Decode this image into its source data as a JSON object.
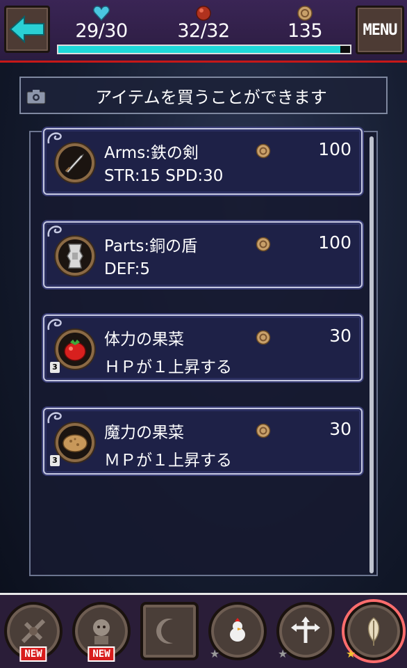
{
  "header": {
    "hp": "29/30",
    "mp": "32/32",
    "gold": "135",
    "menu_label": "MENU",
    "hp_fraction": 0.967
  },
  "notice": {
    "text": "アイテムを買うことができます"
  },
  "shop": {
    "items": [
      {
        "name": "Arms:鉄の剣",
        "desc": "STR:15  SPD:30",
        "price": "100",
        "icon": "iron-sword-icon",
        "qty": ""
      },
      {
        "name": "Parts:銅の盾",
        "desc": "DEF:5",
        "price": "100",
        "icon": "copper-shield-icon",
        "qty": ""
      },
      {
        "name": "体力の果菜",
        "desc": "ＨＰが１上昇する",
        "price": "30",
        "icon": "red-fruit-icon",
        "qty": "3"
      },
      {
        "name": "魔力の果菜",
        "desc": "ＭＰが１上昇する",
        "price": "30",
        "icon": "bread-fruit-icon",
        "qty": "3"
      }
    ]
  },
  "bottom_nav": {
    "items": [
      {
        "icon": "skills-icon",
        "badge": "NEW"
      },
      {
        "icon": "character-icon",
        "badge": "NEW"
      },
      {
        "icon": "moon-icon",
        "badge": ""
      },
      {
        "icon": "chicken-icon",
        "badge": ""
      },
      {
        "icon": "crossroad-icon",
        "badge": ""
      },
      {
        "icon": "feather-icon",
        "badge": ""
      }
    ]
  },
  "colors": {
    "accent": "#1ed8d8",
    "header_line": "#c61818",
    "new_badge": "#d81c1c"
  }
}
